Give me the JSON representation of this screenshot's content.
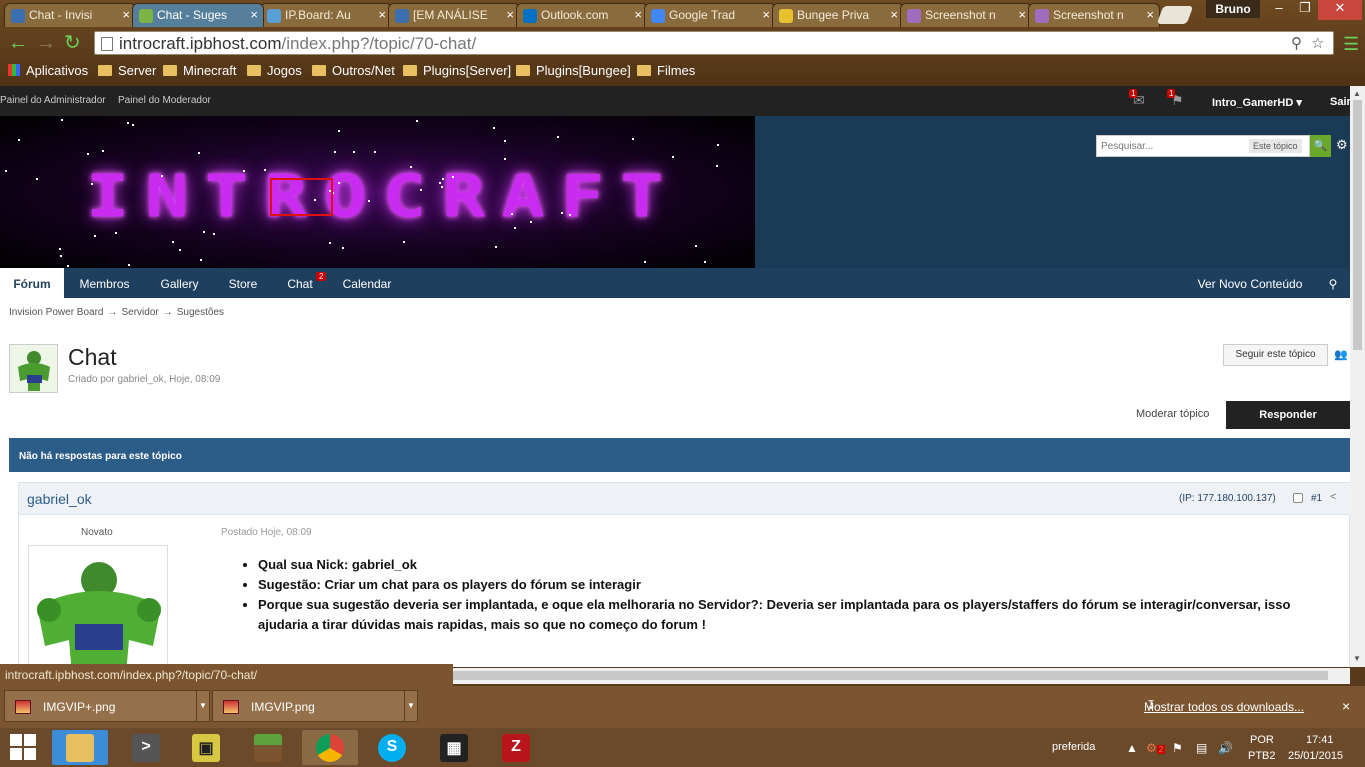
{
  "browser": {
    "tabs": [
      {
        "title": "Chat - Invisi",
        "color": "#3a6fb0",
        "active": false
      },
      {
        "title": "Chat - Suges",
        "color": "#7cb342",
        "active": true
      },
      {
        "title": "IP.Board: Au",
        "color": "#5aa0d8",
        "active": false
      },
      {
        "title": "[EM ANÁLISE",
        "color": "#3a6fb0",
        "active": false
      },
      {
        "title": "Outlook.com",
        "color": "#0072c6",
        "active": false
      },
      {
        "title": "Google Trad",
        "color": "#4285f4",
        "active": false
      },
      {
        "title": "Bungee Priva",
        "color": "#e6c12b",
        "active": false
      },
      {
        "title": "Screenshot n",
        "color": "#a06cc0",
        "active": false
      },
      {
        "title": "Screenshot n",
        "color": "#a06cc0",
        "active": false
      }
    ],
    "user": "Bruno",
    "url_host": "introcraft.ipbhost.com",
    "url_path": "/index.php?/topic/70-chat/",
    "bookmarks": [
      "Aplicativos",
      "Server",
      "Minecraft",
      "Jogos",
      "Outros/Net",
      "Plugins[Server]",
      "Plugins[Bungee]",
      "Filmes"
    ],
    "status_url": "introcraft.ipbhost.com/index.php?/topic/70-chat/"
  },
  "admin_bar": {
    "admin_panel": "Painel do Administrador",
    "mod_panel": "Painel do Moderador",
    "messages_badge": "1",
    "notifications_badge": "1",
    "username": "Intro_GamerHD",
    "username_caret": "▾",
    "exit": "Sair"
  },
  "header": {
    "logo_text": "INTROCRAFT",
    "search_placeholder": "Pesquisar...",
    "search_scope": "Este tópico"
  },
  "nav": {
    "items": [
      {
        "label": "Fórum",
        "active": true
      },
      {
        "label": "Membros"
      },
      {
        "label": "Gallery"
      },
      {
        "label": "Store"
      },
      {
        "label": "Chat",
        "badge": "2"
      },
      {
        "label": "Calendar"
      }
    ],
    "new_content": "Ver Novo Conteúdo"
  },
  "breadcrumb": [
    "Invision Power Board",
    "Servidor",
    "Sugestões"
  ],
  "breadcrumb_sep": "→",
  "topic": {
    "title": "Chat",
    "meta": "Criado por gabriel_ok, Hoje, 08:09",
    "follow": "Seguir este tópico",
    "moderate": "Moderar tópico",
    "reply": "Responder",
    "no_replies": "Não há respostas para este tópico"
  },
  "post": {
    "author": "gabriel_ok",
    "ip": "(IP: 177.180.100.137)",
    "number": "#1",
    "rank": "Novato",
    "date": "Postado Hoje, 08:09",
    "lines": [
      "Qual sua Nick: gabriel_ok",
      "Sugestão: Criar um chat para os players do fórum se interagir",
      "Porque sua sugestão deveria ser implantada, e oque ela melhoraria no Servidor?: Deveria ser implantada para os players/staffers do fórum se interagir/conversar, isso ajudaria a tirar dúvidas mais rapidas, mais so que no começo do forum !"
    ]
  },
  "downloads": {
    "items": [
      "IMGVIP+.png",
      "IMGVIP.png"
    ],
    "show_all": "Mostrar todos os downloads...",
    "close": "×"
  },
  "taskbar": {
    "tray_label": "preferida",
    "lang1": "POR",
    "lang2": "PTB2",
    "time": "17:41",
    "date": "25/01/2015",
    "tray_badge": "2"
  }
}
